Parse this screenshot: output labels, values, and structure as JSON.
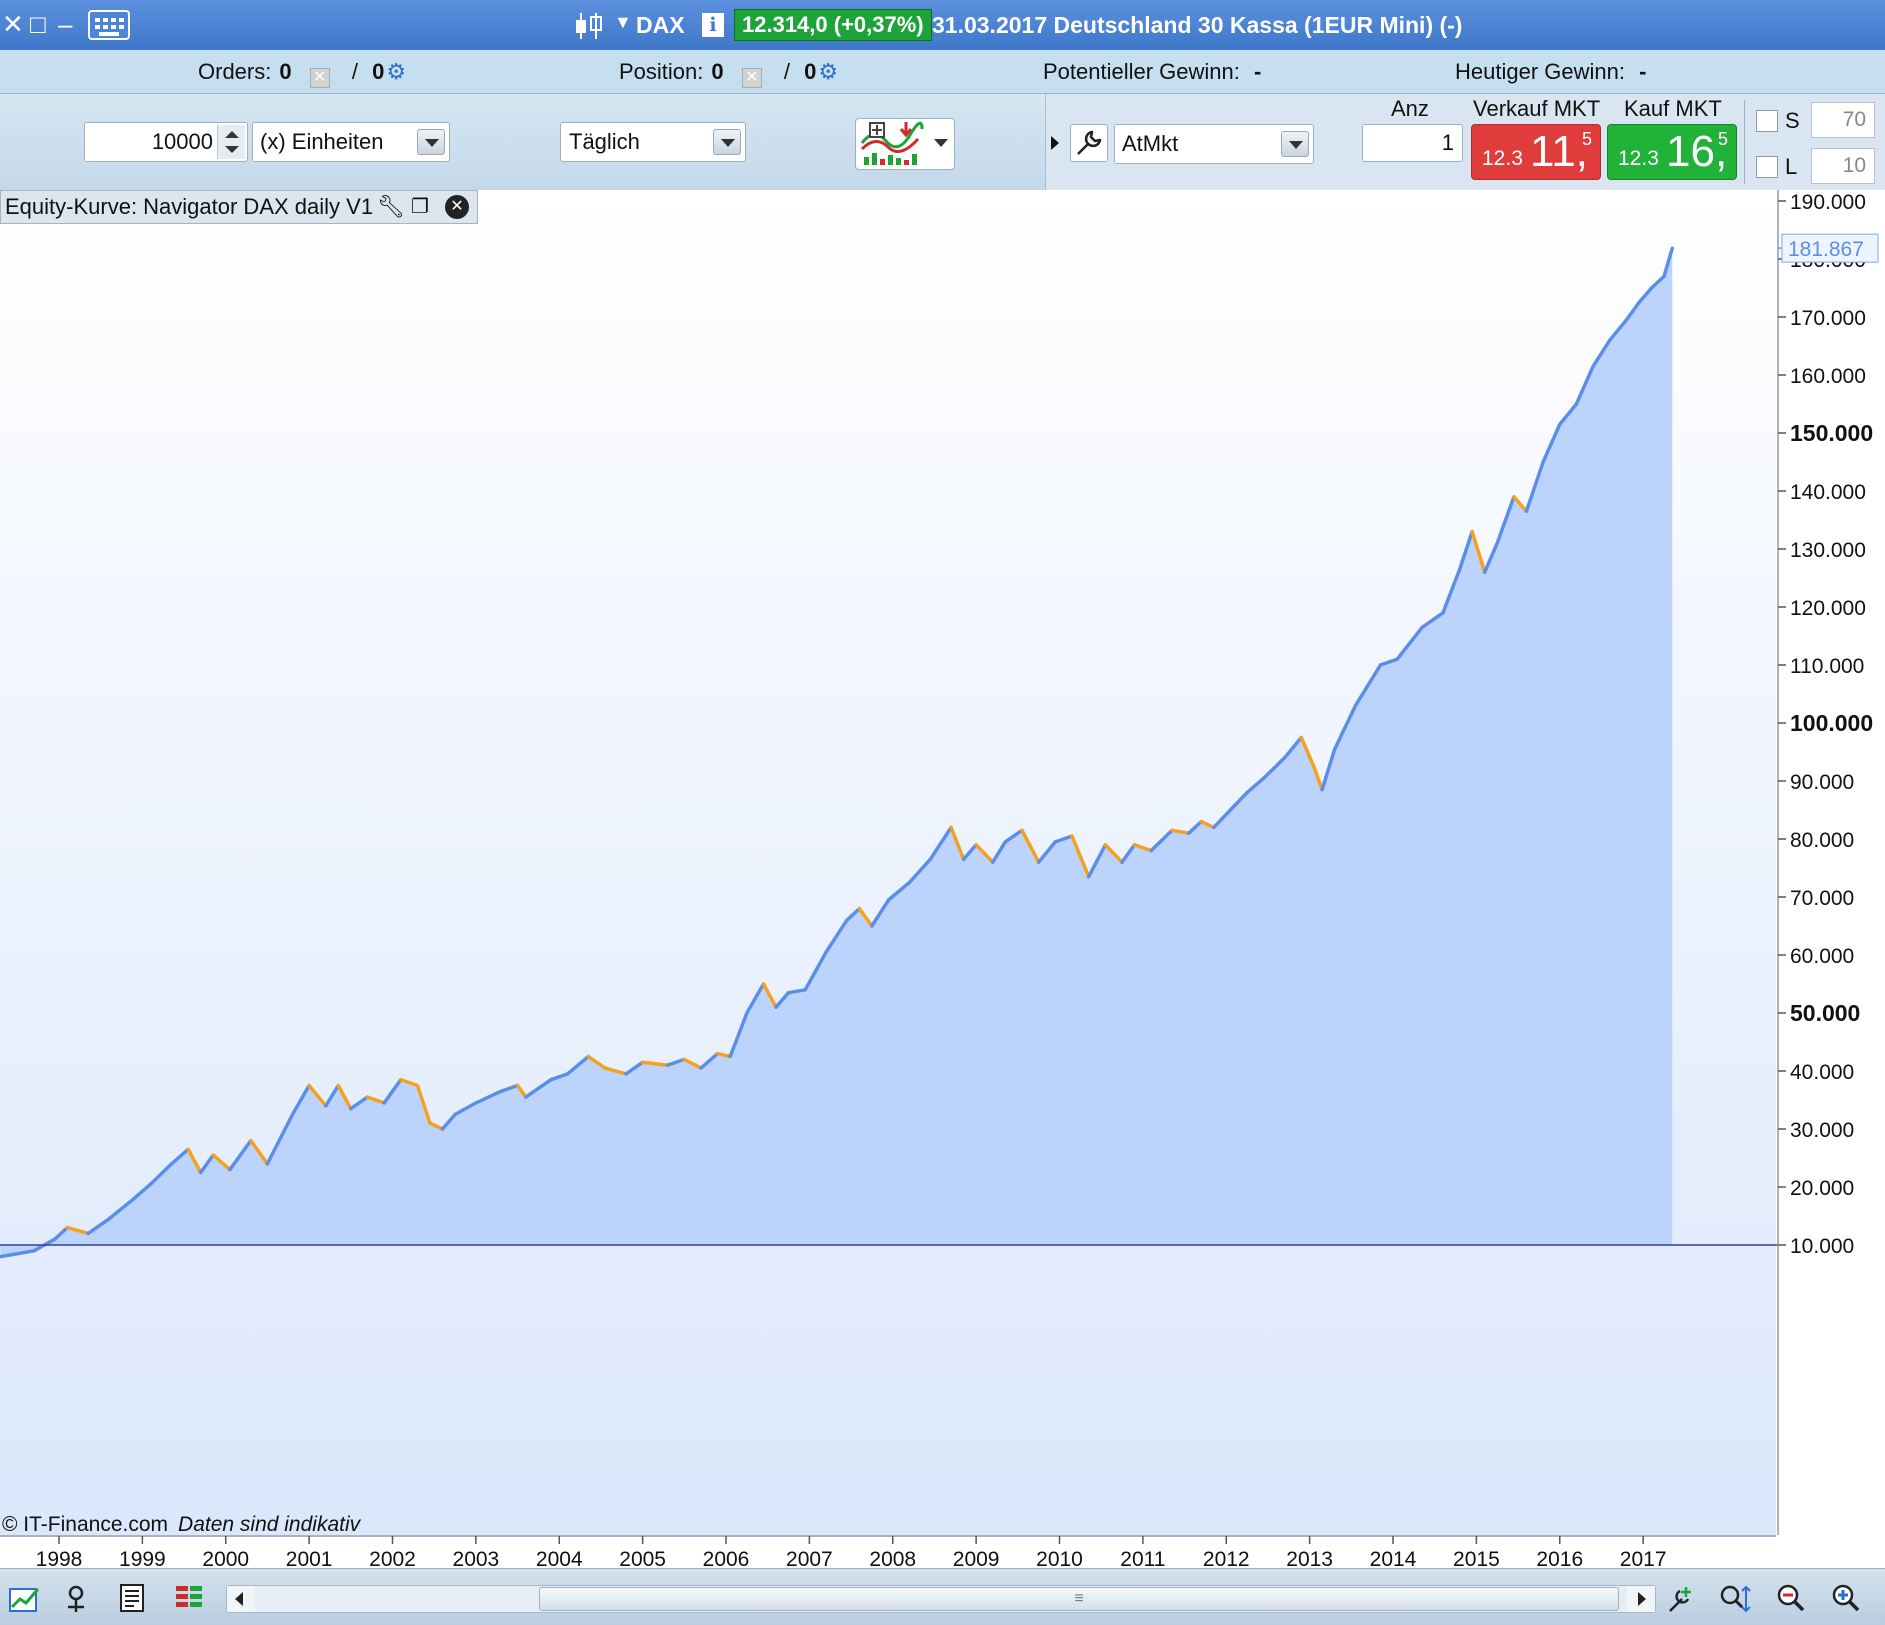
{
  "titlebar": {
    "ticker": "DAX",
    "quote": "12.314,0 (+0,37%)",
    "instrument": "31.03.2017 Deutschland 30 Kassa (1EUR Mini) (-)",
    "colors": {
      "bar": "#4a83d4",
      "quote_badge": "#1da33a"
    }
  },
  "status": {
    "orders_label": "Orders:",
    "orders_value": "0",
    "orders_auto": "0",
    "position_label": "Position:",
    "position_value": "0",
    "position_auto": "0",
    "potential_label": "Potentieller Gewinn:",
    "potential_value": "-",
    "today_label": "Heutiger Gewinn:",
    "today_value": "-",
    "separator": "/"
  },
  "toolbar": {
    "quantity": "10000",
    "unit": "(x) Einheiten",
    "timeframe": "Täglich",
    "order_type": "AtMkt",
    "anz_label": "Anz",
    "anz_value": "1",
    "sell_label": "Verkauf MKT",
    "buy_label": "Kauf MKT",
    "sell_small": "12.3",
    "sell_big": "11,",
    "sell_sup": "5",
    "buy_small": "12.3",
    "buy_big": "16,",
    "buy_sup": "5",
    "s_label": "S",
    "s_value": "70",
    "l_label": "L",
    "l_value": "10",
    "colors": {
      "sell": "#e03c3c",
      "buy": "#22b23a"
    }
  },
  "chart": {
    "header_title": "Equity-Kurve: Navigator DAX daily V1",
    "copyright": "© IT-Finance.com",
    "disclaimer": "Daten sind indikativ"
  },
  "chart_data": {
    "type": "area",
    "title": "Equity-Kurve: Navigator DAX daily V1",
    "xlabel": "",
    "ylabel": "",
    "x_tick_labels": [
      "1998",
      "1999",
      "2000",
      "2001",
      "2002",
      "2003",
      "2004",
      "2005",
      "2006",
      "2007",
      "2008",
      "2009",
      "2010",
      "2011",
      "2012",
      "2013",
      "2014",
      "2015",
      "2016",
      "2017"
    ],
    "x_tick_years": [
      1998,
      1999,
      2000,
      2001,
      2002,
      2003,
      2004,
      2005,
      2006,
      2007,
      2008,
      2009,
      2010,
      2011,
      2012,
      2013,
      2014,
      2015,
      2016,
      2017
    ],
    "y_tick_values": [
      10000,
      20000,
      30000,
      40000,
      50000,
      60000,
      70000,
      80000,
      90000,
      100000,
      110000,
      120000,
      130000,
      140000,
      150000,
      160000,
      170000,
      180000,
      190000
    ],
    "y_tick_labels": [
      "10.000",
      "20.000",
      "30.000",
      "40.000",
      "50.000",
      "60.000",
      "70.000",
      "80.000",
      "90.000",
      "100.000",
      "110.000",
      "120.000",
      "130.000",
      "140.000",
      "150.000",
      "160.000",
      "170.000",
      "180.000",
      "190.000"
    ],
    "y_bold_labels": [
      "50.000",
      "100.000",
      "150.000"
    ],
    "ylim": [
      5000,
      192000
    ],
    "xlim": [
      1997.3,
      2017.95
    ],
    "last_value": 181867,
    "last_value_label": "181.867",
    "baseline_value": 10000,
    "grid": false,
    "colors": {
      "line": "#5b8ee8",
      "drawdown": "#f4a21e",
      "fill": "#bcd4fb",
      "baseline": "#3a3aa0"
    },
    "series": [
      {
        "points": [
          [
            1997.3,
            8000
          ],
          [
            1997.7,
            9000
          ],
          [
            1997.95,
            11000
          ],
          [
            1998.1,
            13000
          ],
          [
            1998.35,
            12000
          ],
          [
            1998.6,
            14500
          ],
          [
            1998.9,
            18000
          ],
          [
            1999.1,
            20500
          ],
          [
            1999.35,
            24000
          ],
          [
            1999.55,
            26500
          ],
          [
            1999.7,
            22500
          ],
          [
            1999.85,
            25500
          ],
          [
            2000.05,
            23000
          ],
          [
            2000.3,
            28000
          ],
          [
            2000.5,
            24000
          ],
          [
            2000.8,
            32500
          ],
          [
            2001.0,
            37500
          ],
          [
            2001.2,
            34000
          ],
          [
            2001.35,
            37500
          ],
          [
            2001.5,
            33500
          ],
          [
            2001.7,
            35500
          ],
          [
            2001.9,
            34500
          ],
          [
            2002.1,
            38500
          ],
          [
            2002.3,
            37500
          ],
          [
            2002.45,
            31000
          ],
          [
            2002.6,
            30000
          ],
          [
            2002.75,
            32500
          ],
          [
            2003.0,
            34500
          ],
          [
            2003.3,
            36500
          ],
          [
            2003.5,
            37500
          ],
          [
            2003.6,
            35500
          ],
          [
            2003.9,
            38500
          ],
          [
            2004.1,
            39500
          ],
          [
            2004.35,
            42500
          ],
          [
            2004.55,
            40500
          ],
          [
            2004.8,
            39500
          ],
          [
            2005.0,
            41500
          ],
          [
            2005.3,
            41000
          ],
          [
            2005.5,
            42000
          ],
          [
            2005.7,
            40500
          ],
          [
            2005.9,
            43000
          ],
          [
            2006.05,
            42500
          ],
          [
            2006.25,
            50000
          ],
          [
            2006.45,
            55000
          ],
          [
            2006.6,
            51000
          ],
          [
            2006.75,
            53500
          ],
          [
            2006.95,
            54000
          ],
          [
            2007.2,
            60500
          ],
          [
            2007.45,
            66000
          ],
          [
            2007.6,
            68000
          ],
          [
            2007.75,
            65000
          ],
          [
            2007.95,
            69500
          ],
          [
            2008.2,
            72500
          ],
          [
            2008.45,
            76500
          ],
          [
            2008.7,
            82000
          ],
          [
            2008.85,
            76500
          ],
          [
            2009.0,
            79000
          ],
          [
            2009.2,
            76000
          ],
          [
            2009.35,
            79500
          ],
          [
            2009.55,
            81500
          ],
          [
            2009.75,
            76000
          ],
          [
            2009.95,
            79500
          ],
          [
            2010.15,
            80500
          ],
          [
            2010.35,
            73500
          ],
          [
            2010.55,
            79000
          ],
          [
            2010.75,
            76000
          ],
          [
            2010.9,
            79000
          ],
          [
            2011.1,
            78000
          ],
          [
            2011.35,
            81500
          ],
          [
            2011.55,
            81000
          ],
          [
            2011.7,
            83000
          ],
          [
            2011.85,
            82000
          ],
          [
            2012.05,
            85000
          ],
          [
            2012.25,
            88000
          ],
          [
            2012.45,
            90500
          ],
          [
            2012.7,
            94000
          ],
          [
            2012.9,
            97500
          ],
          [
            2013.05,
            92500
          ],
          [
            2013.15,
            88500
          ],
          [
            2013.3,
            95500
          ],
          [
            2013.55,
            103000
          ],
          [
            2013.85,
            110000
          ],
          [
            2014.05,
            111000
          ],
          [
            2014.35,
            116500
          ],
          [
            2014.6,
            119000
          ],
          [
            2014.8,
            126500
          ],
          [
            2014.95,
            133000
          ],
          [
            2015.1,
            126000
          ],
          [
            2015.25,
            131000
          ],
          [
            2015.45,
            139000
          ],
          [
            2015.6,
            136500
          ],
          [
            2015.8,
            145000
          ],
          [
            2016.0,
            151500
          ],
          [
            2016.2,
            155000
          ],
          [
            2016.4,
            161500
          ],
          [
            2016.6,
            166000
          ],
          [
            2016.8,
            169500
          ],
          [
            2016.95,
            172500
          ],
          [
            2017.1,
            175000
          ],
          [
            2017.25,
            177000
          ],
          [
            2017.35,
            181867
          ]
        ]
      }
    ]
  }
}
